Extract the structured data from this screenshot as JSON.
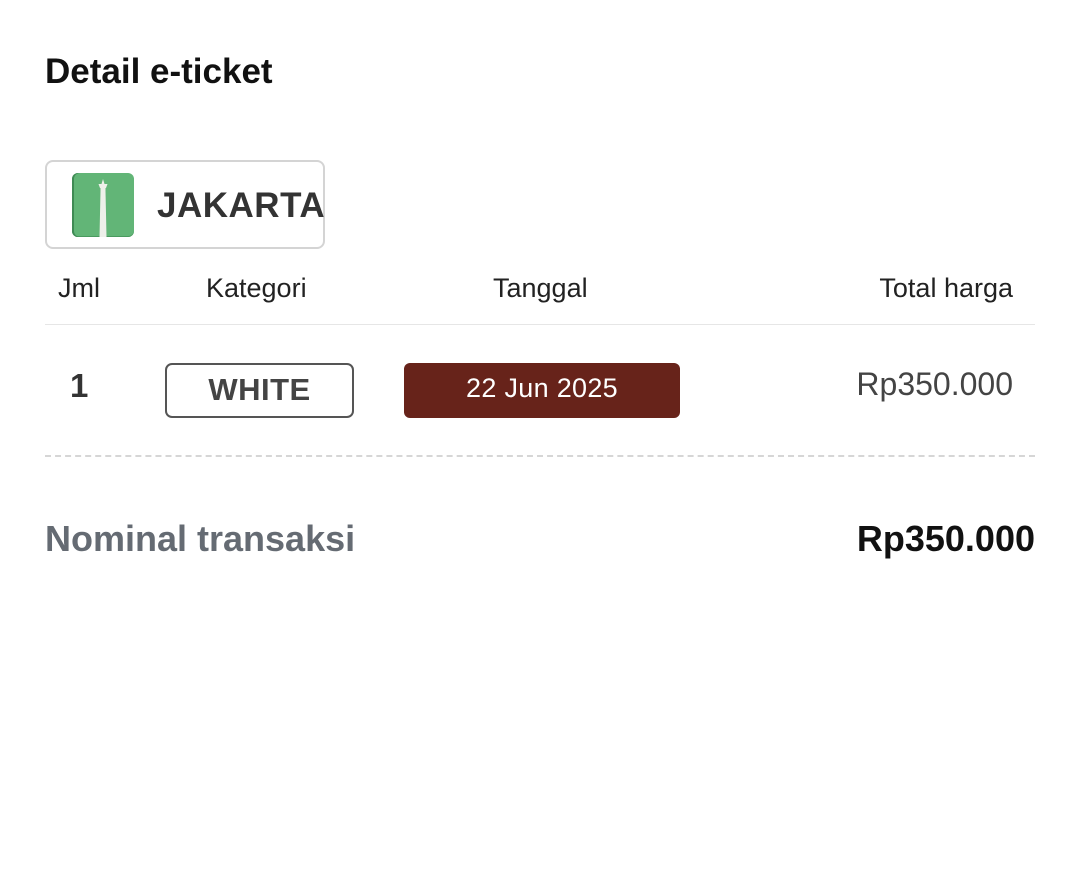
{
  "page": {
    "title": "Detail e-ticket"
  },
  "city": {
    "name": "JAKARTA",
    "logo_icon": "monas-monument-icon",
    "logo_color": "#62b577"
  },
  "table": {
    "headers": {
      "qty": "Jml",
      "category": "Kategori",
      "date": "Tanggal",
      "total": "Total harga"
    },
    "rows": [
      {
        "qty": "1",
        "category": "WHITE",
        "date": "22 Jun 2025",
        "total": "Rp350.000"
      }
    ]
  },
  "summary": {
    "label": "Nominal transaksi",
    "value": "Rp350.000"
  },
  "colors": {
    "date_badge_bg": "#67231a",
    "summary_label": "#656b73"
  }
}
